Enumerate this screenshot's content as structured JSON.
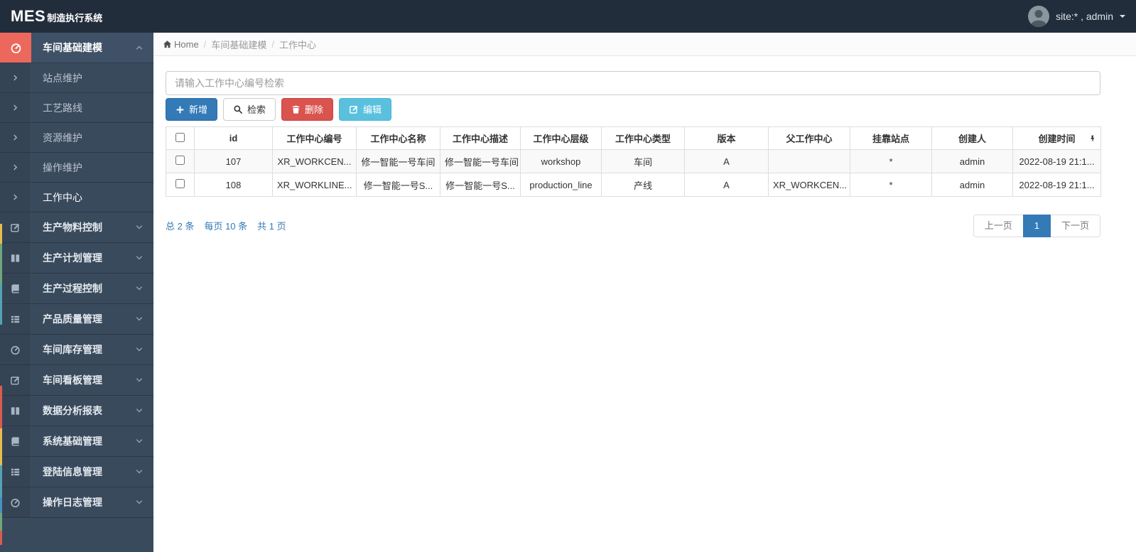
{
  "theme": {
    "navbar_bg": "#222d3c",
    "sidebar_bg": "#3a4a5d",
    "active_icon_tile": "#ec685c",
    "primary": "#337ab7",
    "danger": "#d9534f",
    "info": "#5bc0de",
    "link": "#337ab7",
    "accent_strip_colors": [
      "#e6bd4c",
      "#6fa87b",
      "#52a3b5",
      "#4a90c4",
      "#d95c52"
    ]
  },
  "navbar": {
    "logo_bold": "MES",
    "logo_rest": "制造执行系统",
    "user_label": "site:* , admin"
  },
  "sidebar": {
    "group_active": {
      "label": "车间基础建模"
    },
    "sub_items": [
      {
        "label": "站点维护"
      },
      {
        "label": "工艺路线"
      },
      {
        "label": "资源维护"
      },
      {
        "label": "操作维护"
      },
      {
        "label": "工作中心"
      }
    ],
    "groups": [
      {
        "label": "生产物料控制"
      },
      {
        "label": "生产计划管理"
      },
      {
        "label": "生产过程控制"
      },
      {
        "label": "产品质量管理"
      },
      {
        "label": "车间库存管理"
      },
      {
        "label": "车间看板管理"
      },
      {
        "label": "数据分析报表"
      },
      {
        "label": "系统基础管理"
      },
      {
        "label": "登陆信息管理"
      },
      {
        "label": "操作日志管理"
      }
    ]
  },
  "breadcrumb": {
    "home": "Home",
    "separator": "/",
    "items": [
      "车间基础建模",
      "工作中心"
    ]
  },
  "search": {
    "placeholder": "请输入工作中心编号检索"
  },
  "toolbar": {
    "add": "新增",
    "search": "检索",
    "delete": "删除",
    "edit": "编辑"
  },
  "table": {
    "columns": [
      "id",
      "工作中心编号",
      "工作中心名称",
      "工作中心描述",
      "工作中心层级",
      "工作中心类型",
      "版本",
      "父工作中心",
      "挂靠站点",
      "创建人",
      "创建时间"
    ],
    "rows": [
      [
        "107",
        "XR_WORKCEN...",
        "修一智能一号车间",
        "修一智能一号车间",
        "workshop",
        "车间",
        "A",
        "",
        "*",
        "admin",
        "2022-08-19 21:1..."
      ],
      [
        "108",
        "XR_WORKLINE...",
        "修一智能一号S...",
        "修一智能一号S...",
        "production_line",
        "产线",
        "A",
        "XR_WORKCEN...",
        "*",
        "admin",
        "2022-08-19 21:1..."
      ]
    ]
  },
  "pagination": {
    "summary": [
      "总 2 条",
      "每页 10 条",
      "共 1 页"
    ],
    "prev": "上一页",
    "current": "1",
    "next": "下一页"
  }
}
